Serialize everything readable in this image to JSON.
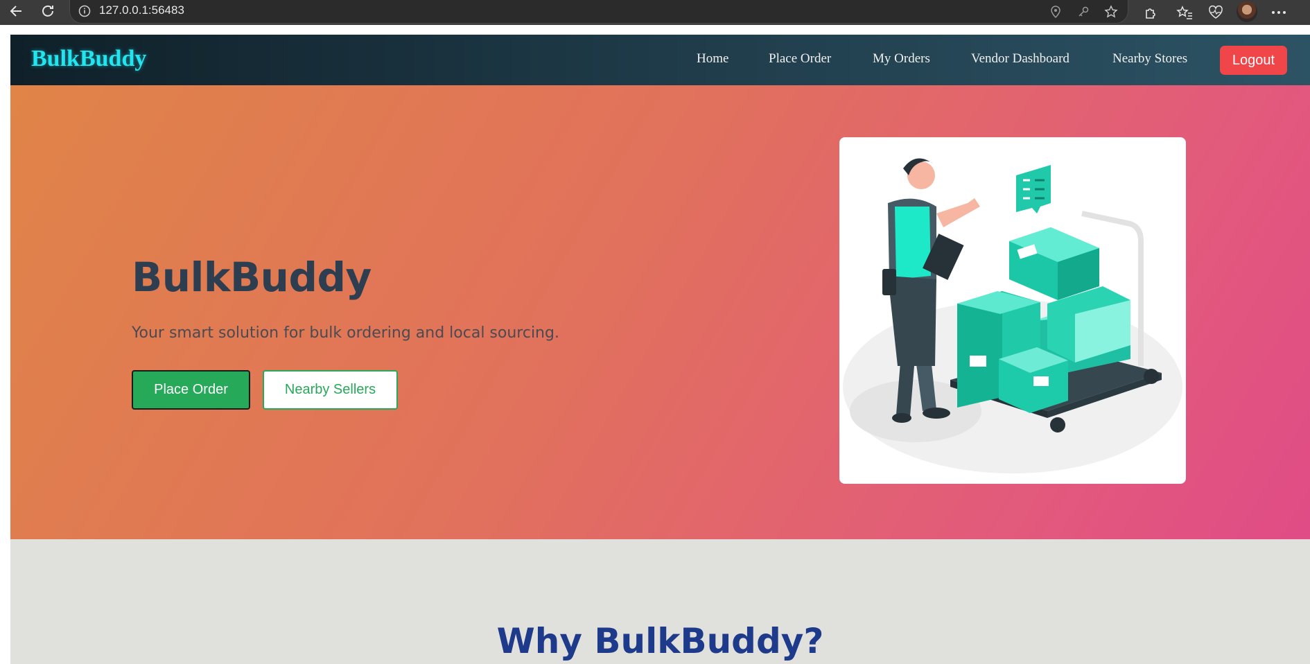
{
  "browser": {
    "url": "127.0.0.1:56483"
  },
  "navbar": {
    "brand": "BulkBuddy",
    "links": [
      "Home",
      "Place Order",
      "My Orders",
      "Vendor Dashboard",
      "Nearby Stores"
    ],
    "logout_label": "Logout"
  },
  "hero": {
    "title": "BulkBuddy",
    "subtitle": "Your smart solution for bulk ordering and local sourcing.",
    "primary_button": "Place Order",
    "secondary_button": "Nearby Sellers"
  },
  "features": {
    "title": "Why BulkBuddy?"
  },
  "colors": {
    "brand": "#22e5f0",
    "primary_green": "#26a958",
    "logout_red": "#f0464a",
    "heading_blue": "#1e3a8a"
  }
}
